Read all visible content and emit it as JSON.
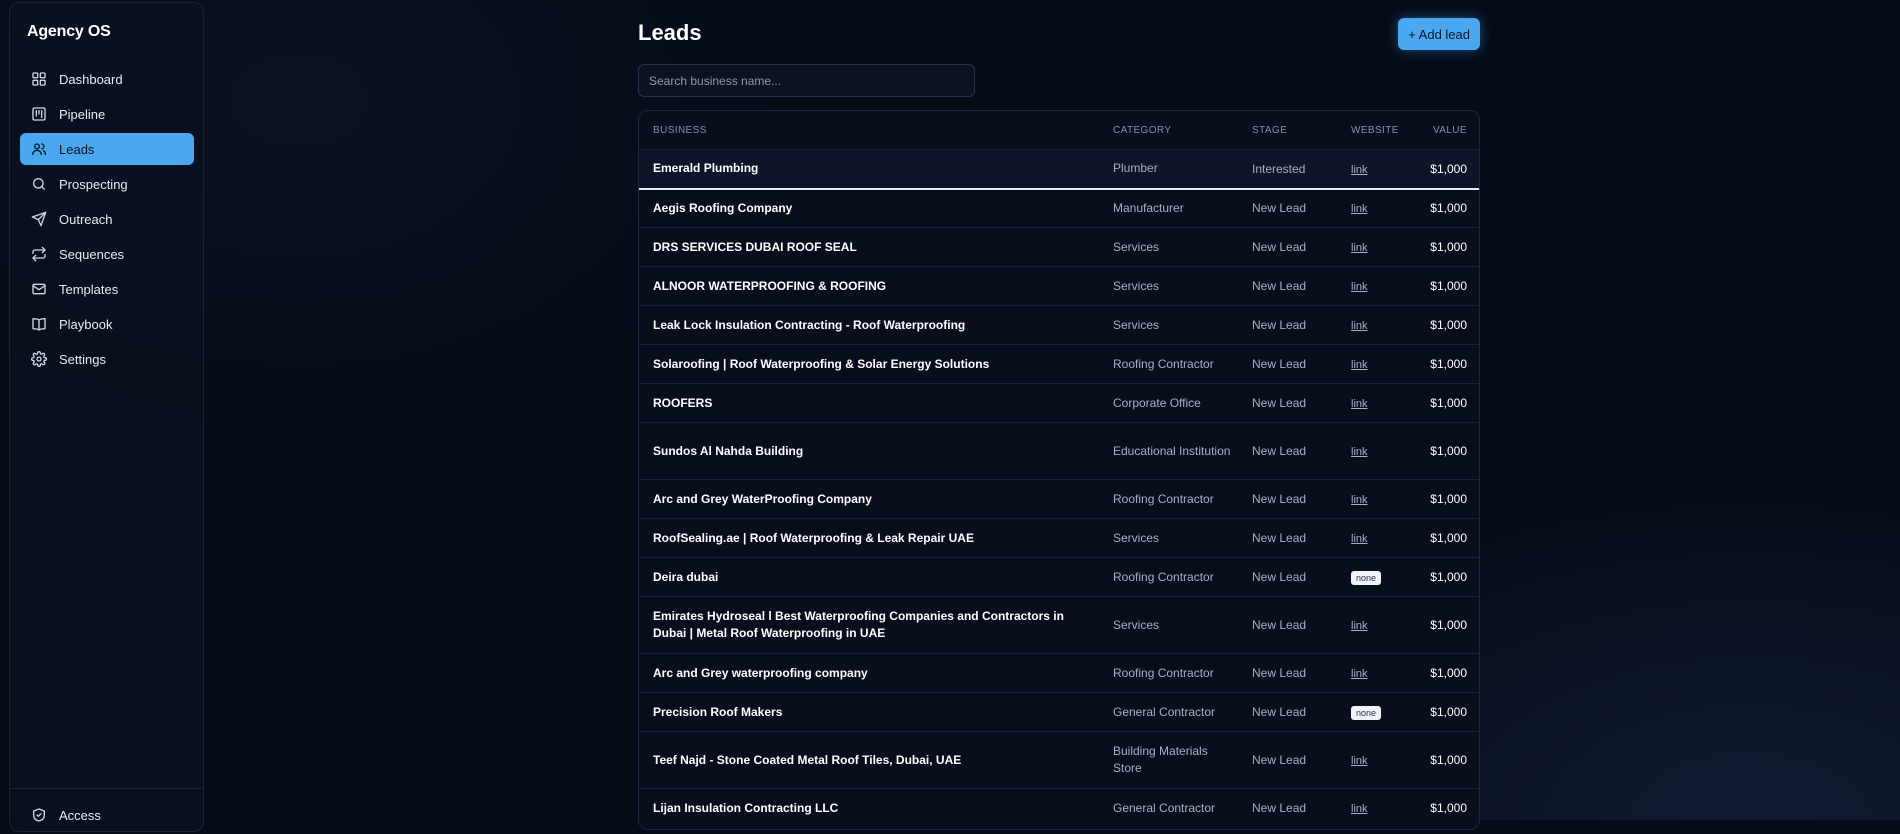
{
  "app": {
    "title": "Agency OS"
  },
  "sidebar": {
    "items": [
      {
        "label": "Dashboard",
        "icon": "dashboard-icon"
      },
      {
        "label": "Pipeline",
        "icon": "pipeline-icon"
      },
      {
        "label": "Leads",
        "icon": "users-icon",
        "active": true
      },
      {
        "label": "Prospecting",
        "icon": "search-icon"
      },
      {
        "label": "Outreach",
        "icon": "send-icon"
      },
      {
        "label": "Sequences",
        "icon": "repeat-icon"
      },
      {
        "label": "Templates",
        "icon": "mail-icon"
      },
      {
        "label": "Playbook",
        "icon": "book-icon"
      },
      {
        "label": "Settings",
        "icon": "gear-icon"
      }
    ],
    "footer": {
      "label": "Access",
      "icon": "shield-icon"
    }
  },
  "page": {
    "title": "Leads",
    "add_button": "+ Add lead",
    "search_placeholder": "Search business name..."
  },
  "table": {
    "columns": [
      "Business",
      "Category",
      "Stage",
      "Website",
      "Value"
    ],
    "rows": [
      {
        "business": "Emerald Plumbing",
        "category": "Plumber",
        "stage": "Interested",
        "website": "link",
        "value": "$1,000"
      },
      {
        "business": "Aegis Roofing Company",
        "category": "Manufacturer",
        "stage": "New Lead",
        "website": "link",
        "value": "$1,000"
      },
      {
        "business": "DRS SERVICES DUBAI ROOF SEAL",
        "category": "Services",
        "stage": "New Lead",
        "website": "link",
        "value": "$1,000"
      },
      {
        "business": "ALNOOR WATERPROOFING & ROOFING",
        "category": "Services",
        "stage": "New Lead",
        "website": "link",
        "value": "$1,000"
      },
      {
        "business": "Leak Lock Insulation Contracting - Roof Waterproofing",
        "category": "Services",
        "stage": "New Lead",
        "website": "link",
        "value": "$1,000"
      },
      {
        "business": "Solaroofing | Roof Waterproofing & Solar Energy Solutions",
        "category": "Roofing Contractor",
        "stage": "New Lead",
        "website": "link",
        "value": "$1,000"
      },
      {
        "business": "ROOFERS",
        "category": "Corporate Office",
        "stage": "New Lead",
        "website": "link",
        "value": "$1,000"
      },
      {
        "business": "Sundos Al Nahda Building",
        "category": "Educational Institution",
        "stage": "New Lead",
        "website": "link",
        "value": "$1,000",
        "tall": true
      },
      {
        "business": "Arc and Grey WaterProofing Company",
        "category": "Roofing Contractor",
        "stage": "New Lead",
        "website": "link",
        "value": "$1,000"
      },
      {
        "business": "RoofSealing.ae | Roof Waterproofing & Leak Repair UAE",
        "category": "Services",
        "stage": "New Lead",
        "website": "link",
        "value": "$1,000"
      },
      {
        "business": "Deira dubai",
        "category": "Roofing Contractor",
        "stage": "New Lead",
        "website": "none",
        "value": "$1,000"
      },
      {
        "business": "Emirates Hydroseal l Best Waterproofing Companies and Contractors in Dubai | Metal Roof Waterproofing in UAE",
        "category": "Services",
        "stage": "New Lead",
        "website": "link",
        "value": "$1,000",
        "tall": true
      },
      {
        "business": "Arc and Grey waterproofing company",
        "category": "Roofing Contractor",
        "stage": "New Lead",
        "website": "link",
        "value": "$1,000"
      },
      {
        "business": "Precision Roof Makers",
        "category": "General Contractor",
        "stage": "New Lead",
        "website": "none",
        "value": "$1,000"
      },
      {
        "business": "Teef Najd - Stone Coated Metal Roof Tiles, Dubai, UAE",
        "category": "Building Materials Store",
        "stage": "New Lead",
        "website": "link",
        "value": "$1,000",
        "tall": true
      },
      {
        "business": "Lijan Insulation Contracting LLC",
        "category": "General Contractor",
        "stage": "New Lead",
        "website": "link",
        "value": "$1,000"
      }
    ]
  }
}
